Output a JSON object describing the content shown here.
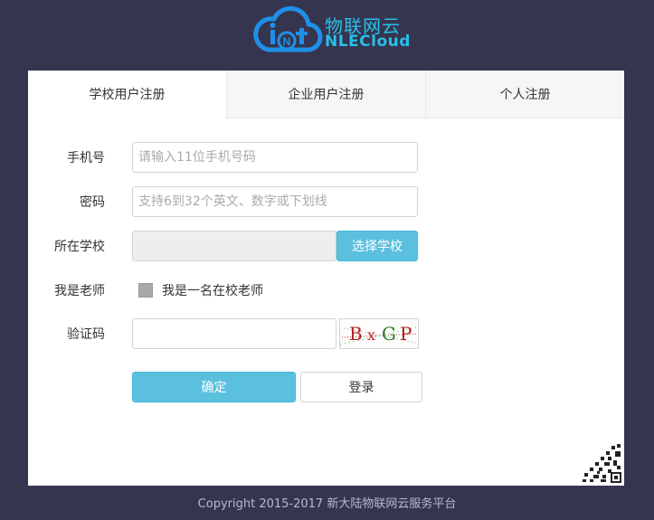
{
  "brand": {
    "cn_name": "物联网云",
    "en_name": "NLECloud",
    "color": "#27c0e8"
  },
  "tabs": [
    {
      "label": "学校用户注册",
      "active": true
    },
    {
      "label": "企业用户注册",
      "active": false
    },
    {
      "label": "个人注册",
      "active": false
    }
  ],
  "form": {
    "phone": {
      "label": "手机号",
      "placeholder": "请输入11位手机号码",
      "value": ""
    },
    "password": {
      "label": "密码",
      "placeholder": "支持6到32个英文、数字或下划线",
      "value": ""
    },
    "school": {
      "label": "所在学校",
      "value": "",
      "button_label": "选择学校"
    },
    "teacher": {
      "label": "我是老师",
      "checkbox_label": "我是一名在校老师",
      "checked": false
    },
    "captcha": {
      "label": "验证码",
      "value": "",
      "code": [
        "B",
        "x",
        "G",
        "P"
      ]
    },
    "submit_label": "确定",
    "login_label": "登录"
  },
  "footer": {
    "text": "Copyright 2015-2017 新大陆物联网云服务平台"
  },
  "colors": {
    "background": "#363550",
    "primary_button": "#5bc0de",
    "tab_inactive": "#f5f6f8"
  }
}
